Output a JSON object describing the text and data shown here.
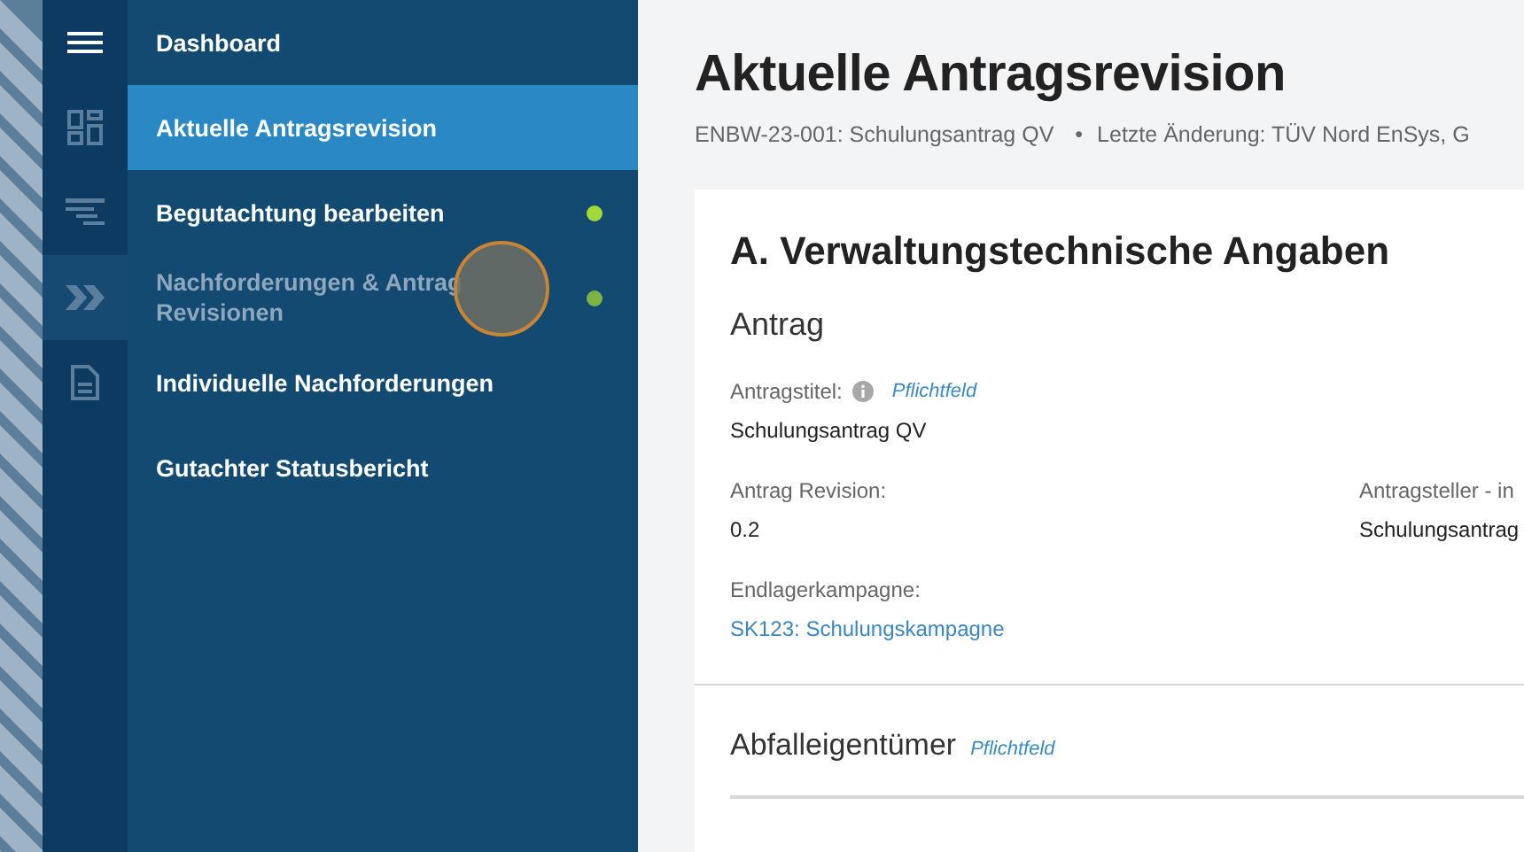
{
  "rail": {
    "items": [
      {
        "kind": "dashboard",
        "selected": false
      },
      {
        "kind": "list",
        "selected": false
      },
      {
        "kind": "chevrons",
        "selected": true
      },
      {
        "kind": "document",
        "selected": false
      }
    ]
  },
  "nav": {
    "items": [
      {
        "label": "Dashboard",
        "selected": false,
        "disabled": false
      },
      {
        "label": "Aktuelle Antragsrevision",
        "selected": true,
        "disabled": false
      },
      {
        "label": "Begutachtung bearbeiten",
        "selected": false,
        "disabled": false,
        "color": "#a4d93a"
      },
      {
        "label": "Nachforderungen & Antrag\nRevisionen",
        "selected": false,
        "disabled": true,
        "color": "#7cb342"
      },
      {
        "label": "Individuelle Nachforderungen",
        "selected": false,
        "disabled": false
      },
      {
        "label": "Gutachter Statusbericht",
        "selected": false,
        "disabled": false
      }
    ]
  },
  "page": {
    "title": "Aktuelle Antragsrevision",
    "subtitle": [
      "ENBW-23-001: Schulungsantrag QV",
      "•",
      "Letzte Änderung: TÜV Nord EnSys, G"
    ]
  },
  "card": {
    "title": "A. Verwaltungstechnische Angaben",
    "section": "Antrag",
    "fields": [
      {
        "label": "Antragstitel:",
        "info": true,
        "required": "Pflichtfeld",
        "value": "Schulungsantrag QV",
        "kind": "text"
      },
      {
        "label": "Antrag Revision:",
        "value": "0.2",
        "kind": "text"
      },
      {
        "label": "Antragsteller - in",
        "value": "Schulungsantrag",
        "kind": "text"
      },
      {
        "label": "Endlagerkampagne:",
        "value": "SK123: Schulungskampagne",
        "kind": "link"
      }
    ],
    "section2": {
      "title": "Abfalleigentümer",
      "required": "Pflichtfeld"
    }
  }
}
